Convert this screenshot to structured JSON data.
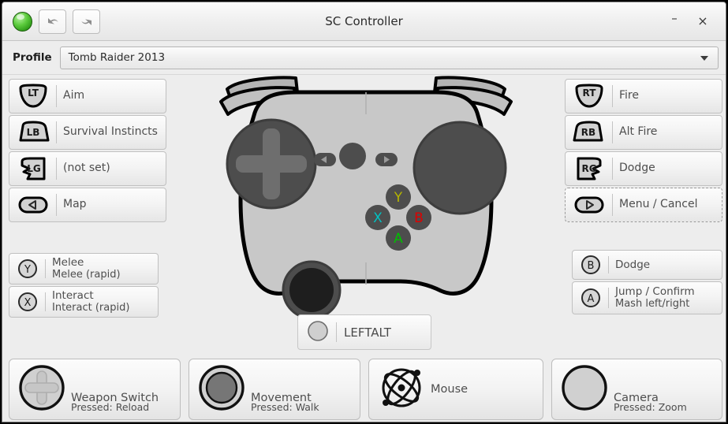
{
  "window": {
    "title": "SC Controller",
    "app_icon": "green-orb-icon",
    "minimize_label": "–",
    "close_label": "×",
    "toolbar": {
      "undo_label": "undo-icon",
      "redo_label": "redo-icon"
    }
  },
  "profile": {
    "label": "Profile",
    "value": "Tomb Raider 2013",
    "placeholder": "Tomb Raider 2013"
  },
  "left_bindings": [
    {
      "glyph": "LT",
      "shape": "trigger",
      "line1": "Aim",
      "line2": ""
    },
    {
      "glyph": "LB",
      "shape": "bumper",
      "line1": "Survival Instincts",
      "line2": ""
    },
    {
      "glyph": "LG",
      "shape": "grip-left",
      "line1": "(not set)",
      "line2": ""
    },
    {
      "glyph": "◁",
      "shape": "pill",
      "line1": "Map",
      "line2": ""
    }
  ],
  "left_face_bindings": [
    {
      "glyph": "Y",
      "shape": "circle",
      "line1": "Melee",
      "line2": "Melee (rapid)"
    },
    {
      "glyph": "X",
      "shape": "circle",
      "line1": "Interact",
      "line2": "Interact (rapid)"
    }
  ],
  "right_bindings": [
    {
      "glyph": "RT",
      "shape": "trigger",
      "line1": "Fire",
      "line2": "",
      "focused": false
    },
    {
      "glyph": "RB",
      "shape": "bumper",
      "line1": "Alt Fire",
      "line2": "",
      "focused": false
    },
    {
      "glyph": "RG",
      "shape": "grip-right",
      "line1": "Dodge",
      "line2": "",
      "focused": false
    },
    {
      "glyph": "▷",
      "shape": "pill",
      "line1": "Menu / Cancel",
      "line2": "",
      "focused": true
    }
  ],
  "right_face_bindings": [
    {
      "glyph": "B",
      "shape": "circle",
      "line1": "Dodge",
      "line2": ""
    },
    {
      "glyph": "A",
      "shape": "circle",
      "line1": "Jump / Confirm",
      "line2": "Mash left/right"
    }
  ],
  "center_binding": {
    "glyph": "circle",
    "label": "LEFTALT"
  },
  "bottom_bindings": [
    {
      "icon": "dpad-icon",
      "title": "Weapon Switch",
      "sub": "Pressed: Reload"
    },
    {
      "icon": "stick-icon",
      "title": "Movement",
      "sub": "Pressed: Walk"
    },
    {
      "icon": "gyro-atom-icon",
      "title": "Mouse",
      "sub": ""
    },
    {
      "icon": "trackpad-icon",
      "title": "Camera",
      "sub": "Pressed: Zoom"
    }
  ],
  "controller_face": {
    "buttons": [
      {
        "name": "Y",
        "color": "#b5b500"
      },
      {
        "name": "X",
        "color": "#00c2c2"
      },
      {
        "name": "B",
        "color": "#e00000"
      },
      {
        "name": "A",
        "color": "#00c000"
      }
    ],
    "center_buttons": [
      "◀",
      "steam",
      "▶"
    ]
  },
  "colors": {
    "window_bg": "#ededed",
    "body_fill": "#c8c8c8",
    "pad_fill": "#4d4d4d",
    "stick_fill": "#1e1e1e",
    "outline": "#000000"
  }
}
